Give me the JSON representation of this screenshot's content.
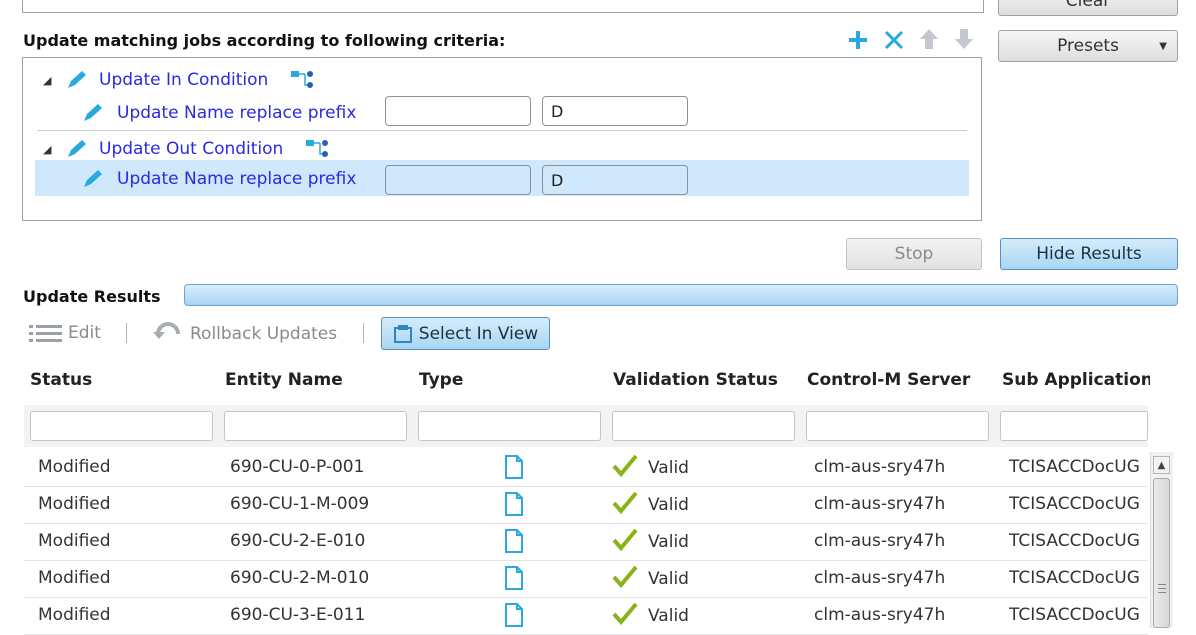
{
  "buttons": {
    "clear": "Clear",
    "presets": "Presets",
    "stop": "Stop",
    "hide_results": "Hide Results"
  },
  "criteria": {
    "title": "Update matching jobs according to following criteria:",
    "groups": [
      {
        "label": "Update In Condition",
        "rule_label": "Update Name replace prefix",
        "old_value": "",
        "new_value": "D"
      },
      {
        "label": "Update Out Condition",
        "rule_label": "Update Name replace prefix",
        "old_value": "",
        "new_value": "D"
      }
    ]
  },
  "results": {
    "title": "Update Results",
    "toolbar": {
      "edit": "Edit",
      "rollback": "Rollback Updates",
      "select_in_view": "Select In View"
    },
    "columns": [
      "Status",
      "Entity Name",
      "Type",
      "Validation Status",
      "Control-M Server",
      "Sub Application"
    ],
    "rows": [
      {
        "status": "Modified",
        "entity": "690-CU-0-P-001",
        "validation": "Valid",
        "server": "clm-aus-sry47h",
        "sub_app": "TCISACCDocUG"
      },
      {
        "status": "Modified",
        "entity": "690-CU-1-M-009",
        "validation": "Valid",
        "server": "clm-aus-sry47h",
        "sub_app": "TCISACCDocUG"
      },
      {
        "status": "Modified",
        "entity": "690-CU-2-E-010",
        "validation": "Valid",
        "server": "clm-aus-sry47h",
        "sub_app": "TCISACCDocUG"
      },
      {
        "status": "Modified",
        "entity": "690-CU-2-M-010",
        "validation": "Valid",
        "server": "clm-aus-sry47h",
        "sub_app": "TCISACCDocUG"
      },
      {
        "status": "Modified",
        "entity": "690-CU-3-E-011",
        "validation": "Valid",
        "server": "clm-aus-sry47h",
        "sub_app": "TCISACCDocUG"
      }
    ]
  },
  "colors": {
    "link": "#2a2ae0",
    "accent": "#29a9e0",
    "selected_row": "#cfe8fb",
    "valid_check": "#8ab31a"
  }
}
